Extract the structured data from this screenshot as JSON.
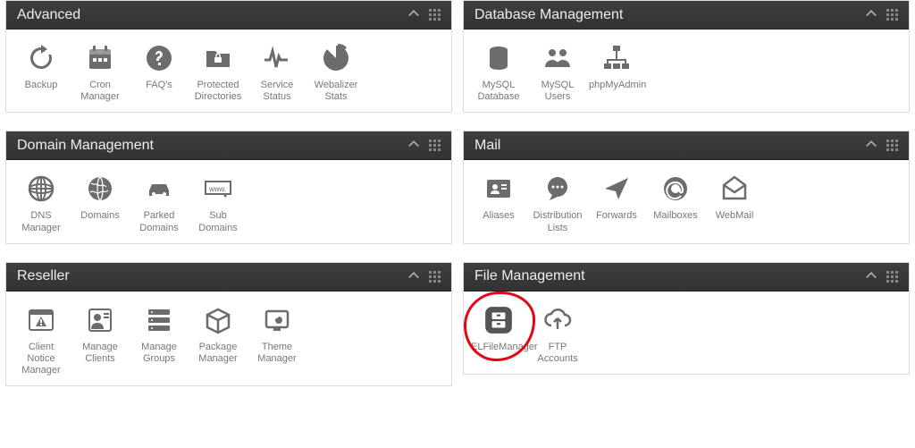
{
  "panels": {
    "advanced": {
      "title": "Advanced",
      "items": [
        {
          "label": "Backup",
          "icon": "refresh-icon"
        },
        {
          "label": "Cron Manager",
          "icon": "calendar-icon"
        },
        {
          "label": "FAQ's",
          "icon": "question-icon"
        },
        {
          "label": "Protected Directories",
          "icon": "folder-lock-icon"
        },
        {
          "label": "Service Status",
          "icon": "pulse-icon"
        },
        {
          "label": "Webalizer Stats",
          "icon": "pie-icon"
        }
      ]
    },
    "database": {
      "title": "Database Management",
      "items": [
        {
          "label": "MySQL Database",
          "icon": "database-icon"
        },
        {
          "label": "MySQL Users",
          "icon": "users-icon"
        },
        {
          "label": "phpMyAdmin",
          "icon": "org-chart-icon"
        }
      ]
    },
    "domain": {
      "title": "Domain Management",
      "items": [
        {
          "label": "DNS Manager",
          "icon": "globe-grid-icon"
        },
        {
          "label": "Domains",
          "icon": "globe-icon"
        },
        {
          "label": "Parked Domains",
          "icon": "car-icon"
        },
        {
          "label": "Sub Domains",
          "icon": "address-bar-icon"
        }
      ]
    },
    "mail": {
      "title": "Mail",
      "items": [
        {
          "label": "Aliases",
          "icon": "id-card-icon"
        },
        {
          "label": "Distribution Lists",
          "icon": "chat-icon"
        },
        {
          "label": "Forwards",
          "icon": "paper-plane-icon"
        },
        {
          "label": "Mailboxes",
          "icon": "at-icon"
        },
        {
          "label": "WebMail",
          "icon": "envelope-open-icon"
        }
      ]
    },
    "reseller": {
      "title": "Reseller",
      "items": [
        {
          "label": "Client Notice Manager",
          "icon": "warning-window-icon"
        },
        {
          "label": "Manage Clients",
          "icon": "client-icon"
        },
        {
          "label": "Manage Groups",
          "icon": "servers-icon"
        },
        {
          "label": "Package Manager",
          "icon": "box-icon"
        },
        {
          "label": "Theme Manager",
          "icon": "theme-icon"
        }
      ]
    },
    "file": {
      "title": "File Management",
      "items": [
        {
          "label": "ELFileManager",
          "icon": "file-manager-icon"
        },
        {
          "label": "FTP Accounts",
          "icon": "cloud-upload-icon"
        }
      ]
    }
  }
}
